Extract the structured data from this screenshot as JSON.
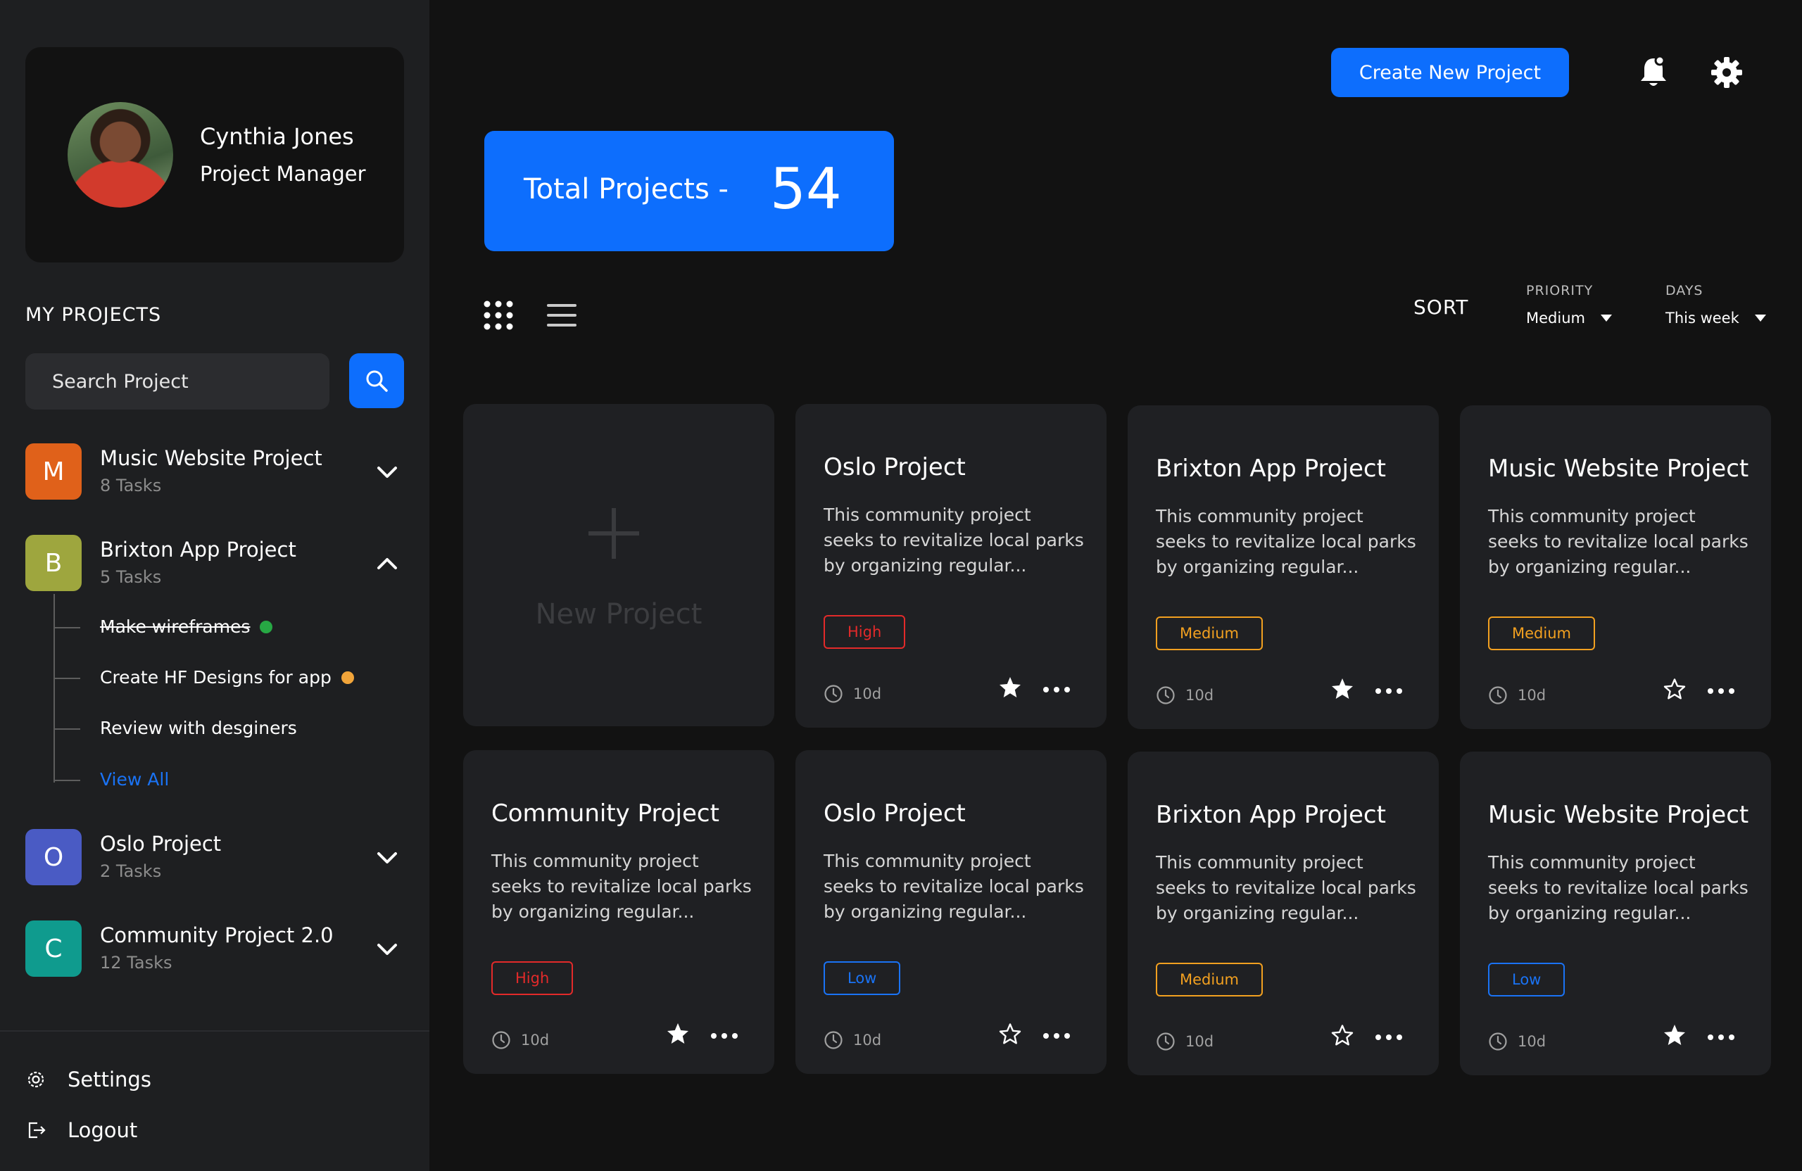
{
  "profile": {
    "name": "Cynthia Jones",
    "role": "Project Manager"
  },
  "sidebar": {
    "heading": "MY PROJECTS",
    "search_placeholder": "Search Project",
    "projects": [
      {
        "letter": "M",
        "name": "Music Website Project",
        "tasks": "8 Tasks",
        "color": "#e0611a",
        "expanded": false
      },
      {
        "letter": "B",
        "name": "Brixton App Project",
        "tasks": "5 Tasks",
        "color": "#9ea63e",
        "expanded": true
      },
      {
        "letter": "O",
        "name": "Oslo Project",
        "tasks": "2 Tasks",
        "color": "#4a5bc4",
        "expanded": false
      },
      {
        "letter": "C",
        "name": "Community Project 2.0",
        "tasks": "12 Tasks",
        "color": "#0f9b8e",
        "expanded": false
      }
    ],
    "subtasks": [
      {
        "label": "Make wireframes",
        "status_color": "#27a844",
        "done": true
      },
      {
        "label": "Create HF Designs for app",
        "status_color": "#f2a53a",
        "done": false
      },
      {
        "label": "Review with desginers",
        "status_color": "",
        "done": false
      }
    ],
    "view_all": "View All",
    "settings": "Settings",
    "logout": "Logout"
  },
  "header": {
    "create_button": "Create New Project"
  },
  "summary": {
    "label": "Total Projects -",
    "count": "54"
  },
  "toolbar": {
    "sort_label": "SORT",
    "priority": {
      "label": "PRIORITY",
      "value": "Medium"
    },
    "days": {
      "label": "DAYS",
      "value": "This week"
    }
  },
  "new_card_label": "New Project",
  "cards": [
    {
      "title": "Oslo Project",
      "desc": "This community project seeks to revitalize local parks by organizing regular...",
      "priority": "High",
      "days": "10d",
      "starred": true
    },
    {
      "title": "Brixton App Project",
      "desc": "This community project seeks to revitalize local parks by organizing regular...",
      "priority": "Medium",
      "days": "10d",
      "starred": true
    },
    {
      "title": "Music Website Project",
      "desc": "This community project seeks to revitalize local parks by organizing regular...",
      "priority": "Medium",
      "days": "10d",
      "starred": false
    },
    {
      "title": "Community Project",
      "desc": "This community project seeks to revitalize local parks by organizing regular...",
      "priority": "High",
      "days": "10d",
      "starred": true
    },
    {
      "title": "Oslo Project",
      "desc": "This community project seeks to revitalize local parks by organizing regular...",
      "priority": "Low",
      "days": "10d",
      "starred": false
    },
    {
      "title": "Brixton App Project",
      "desc": "This community project seeks to revitalize local parks by organizing regular...",
      "priority": "Medium",
      "days": "10d",
      "starred": false
    },
    {
      "title": "Music Website Project",
      "desc": "This community project seeks to revitalize local parks by organizing regular...",
      "priority": "Low",
      "days": "10d",
      "starred": true
    }
  ],
  "colors": {
    "accent": "#0d6efd",
    "high": "#e32a2a",
    "medium": "#f2a020",
    "low": "#1a73f5"
  }
}
